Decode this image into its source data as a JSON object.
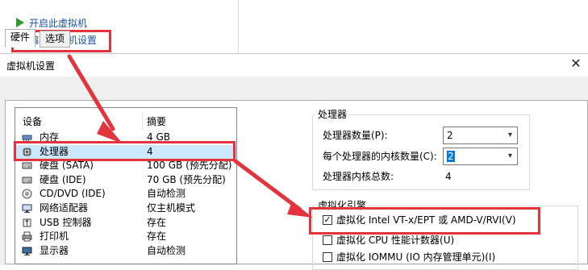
{
  "top_actions": [
    {
      "label": "开启此虚拟机",
      "icon": "play-icon"
    },
    {
      "label": "编辑虚拟机设置",
      "icon": "edit-settings-icon"
    }
  ],
  "dialog": {
    "title": "虚拟机设置",
    "close_glyph": "✕",
    "tabs": [
      {
        "label": "硬件",
        "active": true
      },
      {
        "label": "选项",
        "active": false
      }
    ],
    "device_table": {
      "columns": [
        "设备",
        "摘要"
      ],
      "rows": [
        {
          "device": "内存",
          "summary": "4 GB",
          "icon": "memory-icon",
          "selected": false
        },
        {
          "device": "处理器",
          "summary": "4",
          "icon": "processor-icon",
          "selected": true
        },
        {
          "device": "硬盘 (SATA)",
          "summary": "100 GB (预先分配)",
          "icon": "hard-disk-icon",
          "selected": false
        },
        {
          "device": "硬盘 (IDE)",
          "summary": "70 GB (预先分配)",
          "icon": "hard-disk-icon",
          "selected": false
        },
        {
          "device": "CD/DVD (IDE)",
          "summary": "自动检测",
          "icon": "cd-dvd-icon",
          "selected": false
        },
        {
          "device": "网络适配器",
          "summary": "仅主机模式",
          "icon": "network-adapter-icon",
          "selected": false
        },
        {
          "device": "USB 控制器",
          "summary": "存在",
          "icon": "usb-controller-icon",
          "selected": false
        },
        {
          "device": "打印机",
          "summary": "存在",
          "icon": "printer-icon",
          "selected": false
        },
        {
          "device": "显示器",
          "summary": "自动检测",
          "icon": "display-icon",
          "selected": false
        }
      ]
    },
    "processor": {
      "group_title": "处理器",
      "num_processors_label": "处理器数量(P):",
      "num_processors_value": "2",
      "cores_per_processor_label": "每个处理器的内核数量(C):",
      "cores_per_processor_value": "2",
      "total_cores_label": "处理器内核总数:",
      "total_cores_value": "4"
    },
    "virtualization": {
      "group_title": "虚拟化引擎",
      "options": [
        {
          "label": "虚拟化 Intel VT-x/EPT 或 AMD-V/RVI(V)",
          "checked": true
        },
        {
          "label": "虚拟化 CPU 性能计数器(U)",
          "checked": false
        },
        {
          "label": "虚拟化 IOMMU (IO 内存管理单元)(I)",
          "checked": false
        }
      ]
    }
  },
  "colors": {
    "annotation_red": "#e3343e",
    "link_blue": "#1a56a8",
    "selection": "#cce8ff",
    "play_green": "#2c9a2c"
  },
  "check_glyph": "✓",
  "combo_arrow_glyph": "⌄"
}
